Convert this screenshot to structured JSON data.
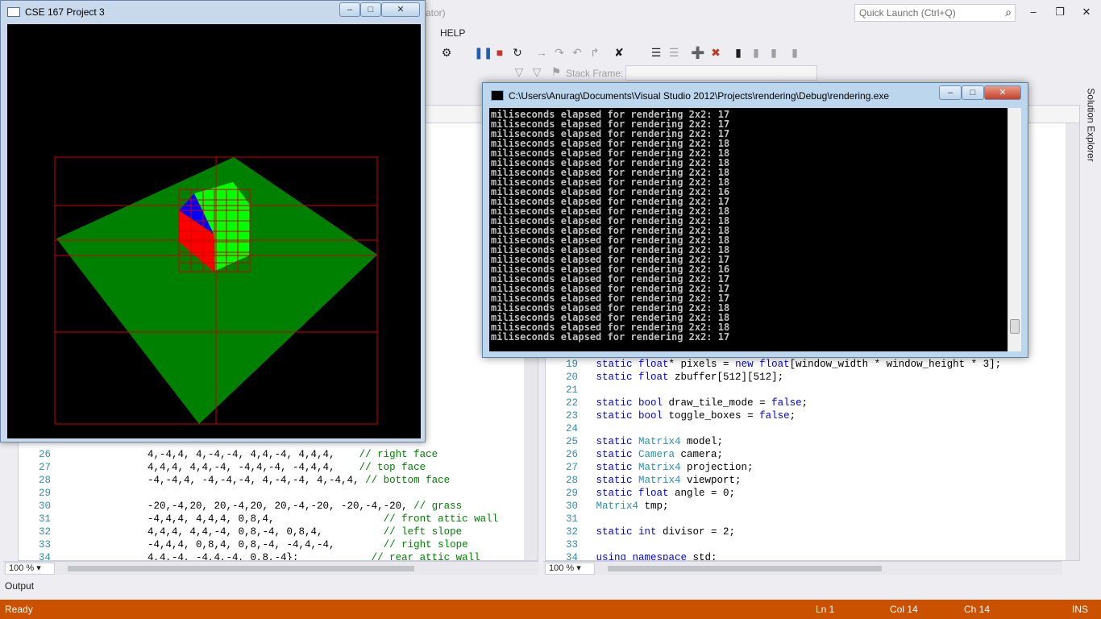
{
  "vs": {
    "title_fragment": "ator)",
    "quick_launch_placeholder": "Quick Launch (Ctrl+Q)",
    "menu": {
      "help": "HELP"
    },
    "stack_frame_label": "Stack Frame:",
    "solution_explorer_label": "Solution Explorer",
    "output_label": "Output"
  },
  "editor_left": {
    "zoom": "100 %",
    "lines": [
      {
        "num": "26",
        "code": "              4,-4,4, 4,-4,-4, 4,4,-4, 4,4,4,",
        "comment": "    // right face"
      },
      {
        "num": "27",
        "code": "              4,4,4, 4,4,-4, -4,4,-4, -4,4,4,",
        "comment": "    // top face"
      },
      {
        "num": "28",
        "code": "              -4,-4,4, -4,-4,-4, 4,-4,-4, 4,-4,4,",
        "comment": " // bottom face"
      },
      {
        "num": "29",
        "code": "",
        "comment": ""
      },
      {
        "num": "30",
        "code": "              -20,-4,20, 20,-4,20, 20,-4,-20, -20,-4,-20,",
        "comment": " // grass"
      },
      {
        "num": "31",
        "code": "              -4,4,4, 4,4,4, 0,8,4,",
        "comment": "                  // front attic wall"
      },
      {
        "num": "32",
        "code": "              4,4,4, 4,4,-4, 0,8,-4, 0,8,4,",
        "comment": "          // left slope"
      },
      {
        "num": "33",
        "code": "              -4,4,4, 0,8,4, 0,8,-4, -4,4,-4,",
        "comment": "        // right slope"
      },
      {
        "num": "34",
        "code": "              4,4,-4, -4,4,-4, 0,8,-4};",
        "comment": "            // rear attic wall"
      }
    ]
  },
  "editor_right": {
    "zoom": "100 %",
    "lines": [
      {
        "num": "19",
        "tokens": [
          [
            "kw",
            "static "
          ],
          [
            "kw",
            "float"
          ],
          [
            "tx",
            "* pixels = "
          ],
          [
            "kw",
            "new "
          ],
          [
            "kw",
            "float"
          ],
          [
            "tx",
            "[window_width * window_height * 3];"
          ]
        ]
      },
      {
        "num": "20",
        "tokens": [
          [
            "kw",
            "static "
          ],
          [
            "kw",
            "float "
          ],
          [
            "tx",
            "zbuffer[512][512];"
          ]
        ]
      },
      {
        "num": "21",
        "tokens": []
      },
      {
        "num": "22",
        "tokens": [
          [
            "kw",
            "static "
          ],
          [
            "kw",
            "bool "
          ],
          [
            "tx",
            "draw_tile_mode = "
          ],
          [
            "kw",
            "false"
          ],
          [
            "tx",
            ";"
          ]
        ]
      },
      {
        "num": "23",
        "tokens": [
          [
            "kw",
            "static "
          ],
          [
            "kw",
            "bool "
          ],
          [
            "tx",
            "toggle_boxes = "
          ],
          [
            "kw",
            "false"
          ],
          [
            "tx",
            ";"
          ]
        ]
      },
      {
        "num": "24",
        "tokens": []
      },
      {
        "num": "25",
        "tokens": [
          [
            "kw",
            "static "
          ],
          [
            "ty",
            "Matrix4 "
          ],
          [
            "tx",
            "model;"
          ]
        ]
      },
      {
        "num": "26",
        "tokens": [
          [
            "kw",
            "static "
          ],
          [
            "ty",
            "Camera "
          ],
          [
            "tx",
            "camera;"
          ]
        ]
      },
      {
        "num": "27",
        "tokens": [
          [
            "kw",
            "static "
          ],
          [
            "ty",
            "Matrix4 "
          ],
          [
            "tx",
            "projection;"
          ]
        ]
      },
      {
        "num": "28",
        "tokens": [
          [
            "kw",
            "static "
          ],
          [
            "ty",
            "Matrix4 "
          ],
          [
            "tx",
            "viewport;"
          ]
        ]
      },
      {
        "num": "29",
        "tokens": [
          [
            "kw",
            "static "
          ],
          [
            "kw",
            "float "
          ],
          [
            "tx",
            "angle = 0;"
          ]
        ]
      },
      {
        "num": "30",
        "tokens": [
          [
            "ty",
            "Matrix4 "
          ],
          [
            "tx",
            "tmp;"
          ]
        ]
      },
      {
        "num": "31",
        "tokens": []
      },
      {
        "num": "32",
        "tokens": [
          [
            "kw",
            "static "
          ],
          [
            "kw",
            "int "
          ],
          [
            "tx",
            "divisor = 2;"
          ]
        ]
      },
      {
        "num": "33",
        "tokens": []
      },
      {
        "num": "34",
        "tokens": [
          [
            "kw",
            "using "
          ],
          [
            "kw",
            "namespace "
          ],
          [
            "tx",
            "std;"
          ]
        ]
      }
    ]
  },
  "console": {
    "title": "C:\\Users\\Anurag\\Documents\\Visual Studio 2012\\Projects\\rendering\\Debug\\rendering.exe",
    "line_prefix": "miliseconds elapsed for rendering 2x2: ",
    "values": [
      17,
      17,
      17,
      18,
      18,
      18,
      18,
      18,
      16,
      17,
      18,
      18,
      18,
      18,
      18,
      17,
      16,
      17,
      17,
      17,
      18,
      18,
      18,
      17
    ]
  },
  "glwindow": {
    "title": "CSE 167 Project 3"
  },
  "status": {
    "ready": "Ready",
    "ln": "Ln 1",
    "col": "Col 14",
    "ch": "Ch 14",
    "ins": "INS"
  },
  "colors": {
    "status_bar": "#ca5100",
    "grass": "#008000",
    "cube_light": "#00ff00",
    "cube_red": "#ff0000",
    "cube_blue": "#0000ff",
    "tile_lines": "#cc0000"
  }
}
